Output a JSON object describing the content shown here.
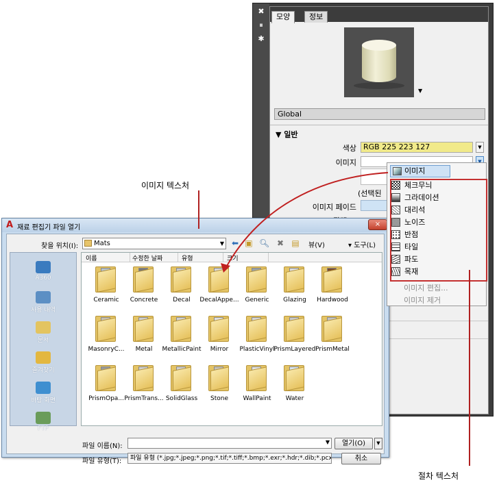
{
  "panel": {
    "tabs": [
      "모양",
      "정보"
    ],
    "material_name": "Global",
    "section_title": "▼ 일반",
    "props": {
      "color_label": "색상",
      "color_value": "RGB 225 223 127",
      "image_label": "이미지",
      "selection_hint": "(선택된",
      "image_fade_label": "이미지 페이드",
      "glossiness_label": "광택"
    }
  },
  "menu": {
    "header": "이미지",
    "procedural_items": [
      "체크무늬",
      "그라데이션",
      "대리석",
      "노이즈",
      "반점",
      "타일",
      "파도",
      "목재"
    ],
    "disabled_items": [
      "이미지 편집...",
      "이미지 제거"
    ]
  },
  "callouts": {
    "image_texture": "이미지 텍스처",
    "procedural_texture": "절차 텍스처"
  },
  "dialog": {
    "title": "재료 편집기 파일 열기",
    "close_label": "×",
    "lookin_label": "찾을 위치(I):",
    "lookin_value": "Mats",
    "views_label": "뷰(V)",
    "tools_label": "▾ 도구(L)",
    "places": [
      "A360",
      "사용 내역",
      "문서",
      "즐겨찾기",
      "바탕 화면",
      "FTP"
    ],
    "columns": [
      "이름",
      "수정한 날짜",
      "유형",
      "크기"
    ],
    "folders": [
      "Ceramic",
      "Concrete",
      "Decal",
      "DecalAppe...",
      "Generic",
      "Glazing",
      "Hardwood",
      "MasonryC...",
      "Metal",
      "MetallicPaint",
      "Mirror",
      "PlasticVinyl",
      "PrismLayered",
      "PrismMetal",
      "PrismOpa...",
      "PrismTrans...",
      "SolidGlass",
      "Stone",
      "WallPaint",
      "Water"
    ],
    "filename_label": "파일 이름(N):",
    "filetype_label": "파일 유형(T):",
    "filetype_value": "파일 유형 (*.jpg;*.jpeg;*.png;*.tif;*.tiff;*.bmp;*.exr;*.hdr;*.dib;*.pcx",
    "open_label": "열기(O)",
    "cancel_label": "취소"
  }
}
